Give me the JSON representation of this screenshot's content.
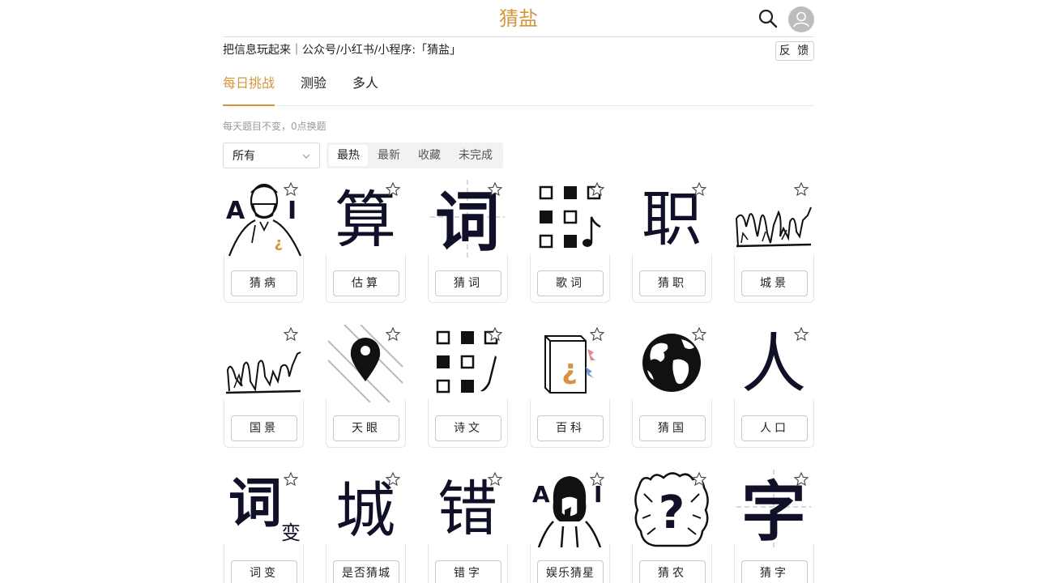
{
  "header": {
    "brand": "猜盐",
    "tagline": "把信息玩起来｜公众号/小红书/小程序:「猜盐」",
    "feedback_label": "反 馈",
    "brand_color": "#d4953c"
  },
  "tabs": [
    {
      "label": "每日挑战",
      "active": true
    },
    {
      "label": "测验",
      "active": false
    },
    {
      "label": "多人",
      "active": false
    }
  ],
  "hint": "每天题目不变，0点换题",
  "filters": {
    "category_value": "所有",
    "sort_options": [
      "最热",
      "最新",
      "收藏",
      "未完成"
    ],
    "sort_selected": "最热"
  },
  "games": [
    {
      "label": "猜病",
      "icon": "ai-doctor-icon"
    },
    {
      "label": "估算",
      "icon": "suan-character-icon"
    },
    {
      "label": "猜词",
      "icon": "ci-character-icon"
    },
    {
      "label": "歌词",
      "icon": "grid-music-note-icon"
    },
    {
      "label": "猜职",
      "icon": "zhi-character-icon"
    },
    {
      "label": "城景",
      "icon": "skyline-sketch-icon"
    },
    {
      "label": "国景",
      "icon": "skyline-sketch-icon"
    },
    {
      "label": "天眼",
      "icon": "map-pin-icon"
    },
    {
      "label": "诗文",
      "icon": "grid-brush-icon"
    },
    {
      "label": "百科",
      "icon": "encyclopedia-book-icon"
    },
    {
      "label": "猜国",
      "icon": "globe-icon"
    },
    {
      "label": "人口",
      "icon": "ren-character-icon"
    },
    {
      "label": "词变",
      "icon": "ci-bian-icon"
    },
    {
      "label": "是否猜城",
      "icon": "cheng-character-icon"
    },
    {
      "label": "错字",
      "icon": "cuo-character-icon"
    },
    {
      "label": "娱乐猜星",
      "icon": "ai-celebrity-icon"
    },
    {
      "label": "猜农",
      "icon": "question-face-icon"
    },
    {
      "label": "猜字",
      "icon": "zi-character-icon"
    }
  ],
  "art_text": {
    "ai_mark": "A",
    "ai_mark2": "I",
    "suan": "算",
    "ci": "词",
    "zhi": "职",
    "ren": "人",
    "bian": "变",
    "cheng": "城",
    "cuo": "错",
    "zi": "字",
    "q": "?"
  }
}
